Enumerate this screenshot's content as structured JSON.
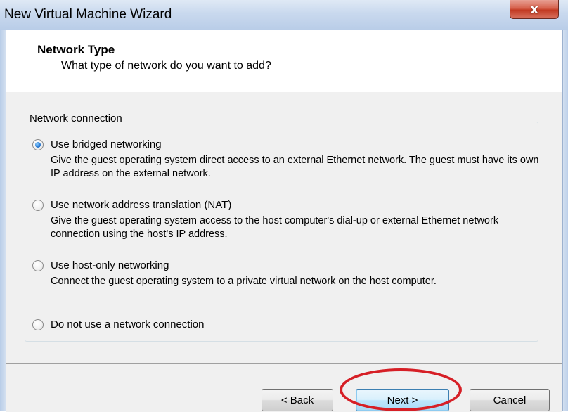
{
  "window": {
    "title": "New Virtual Machine Wizard",
    "close_glyph": "x"
  },
  "header": {
    "title": "Network Type",
    "subtitle": "What type of network do you want to add?"
  },
  "group": {
    "label": "Network connection",
    "options": [
      {
        "label": "Use bridged networking",
        "description": "Give the guest operating system direct access to an external Ethernet network. The guest must have its own IP address on the external network.",
        "selected": true
      },
      {
        "label": "Use network address translation (NAT)",
        "description": "Give the guest operating system access to the host computer's dial-up or external Ethernet network connection using the host's IP address.",
        "selected": false
      },
      {
        "label": "Use host-only networking",
        "description": "Connect the guest operating system to a private virtual network on the host computer.",
        "selected": false
      },
      {
        "label": "Do not use a network connection",
        "description": "",
        "selected": false
      }
    ]
  },
  "buttons": {
    "back": "< Back",
    "next": "Next >",
    "cancel": "Cancel"
  },
  "annotation": {
    "color": "#d61f26",
    "target": "next-button"
  },
  "colors": {
    "title_bar": "#c9d9ee",
    "body_bg": "#f0f0f0",
    "close_button": "#c23a22",
    "radio_selected": "#2f7fd6"
  }
}
